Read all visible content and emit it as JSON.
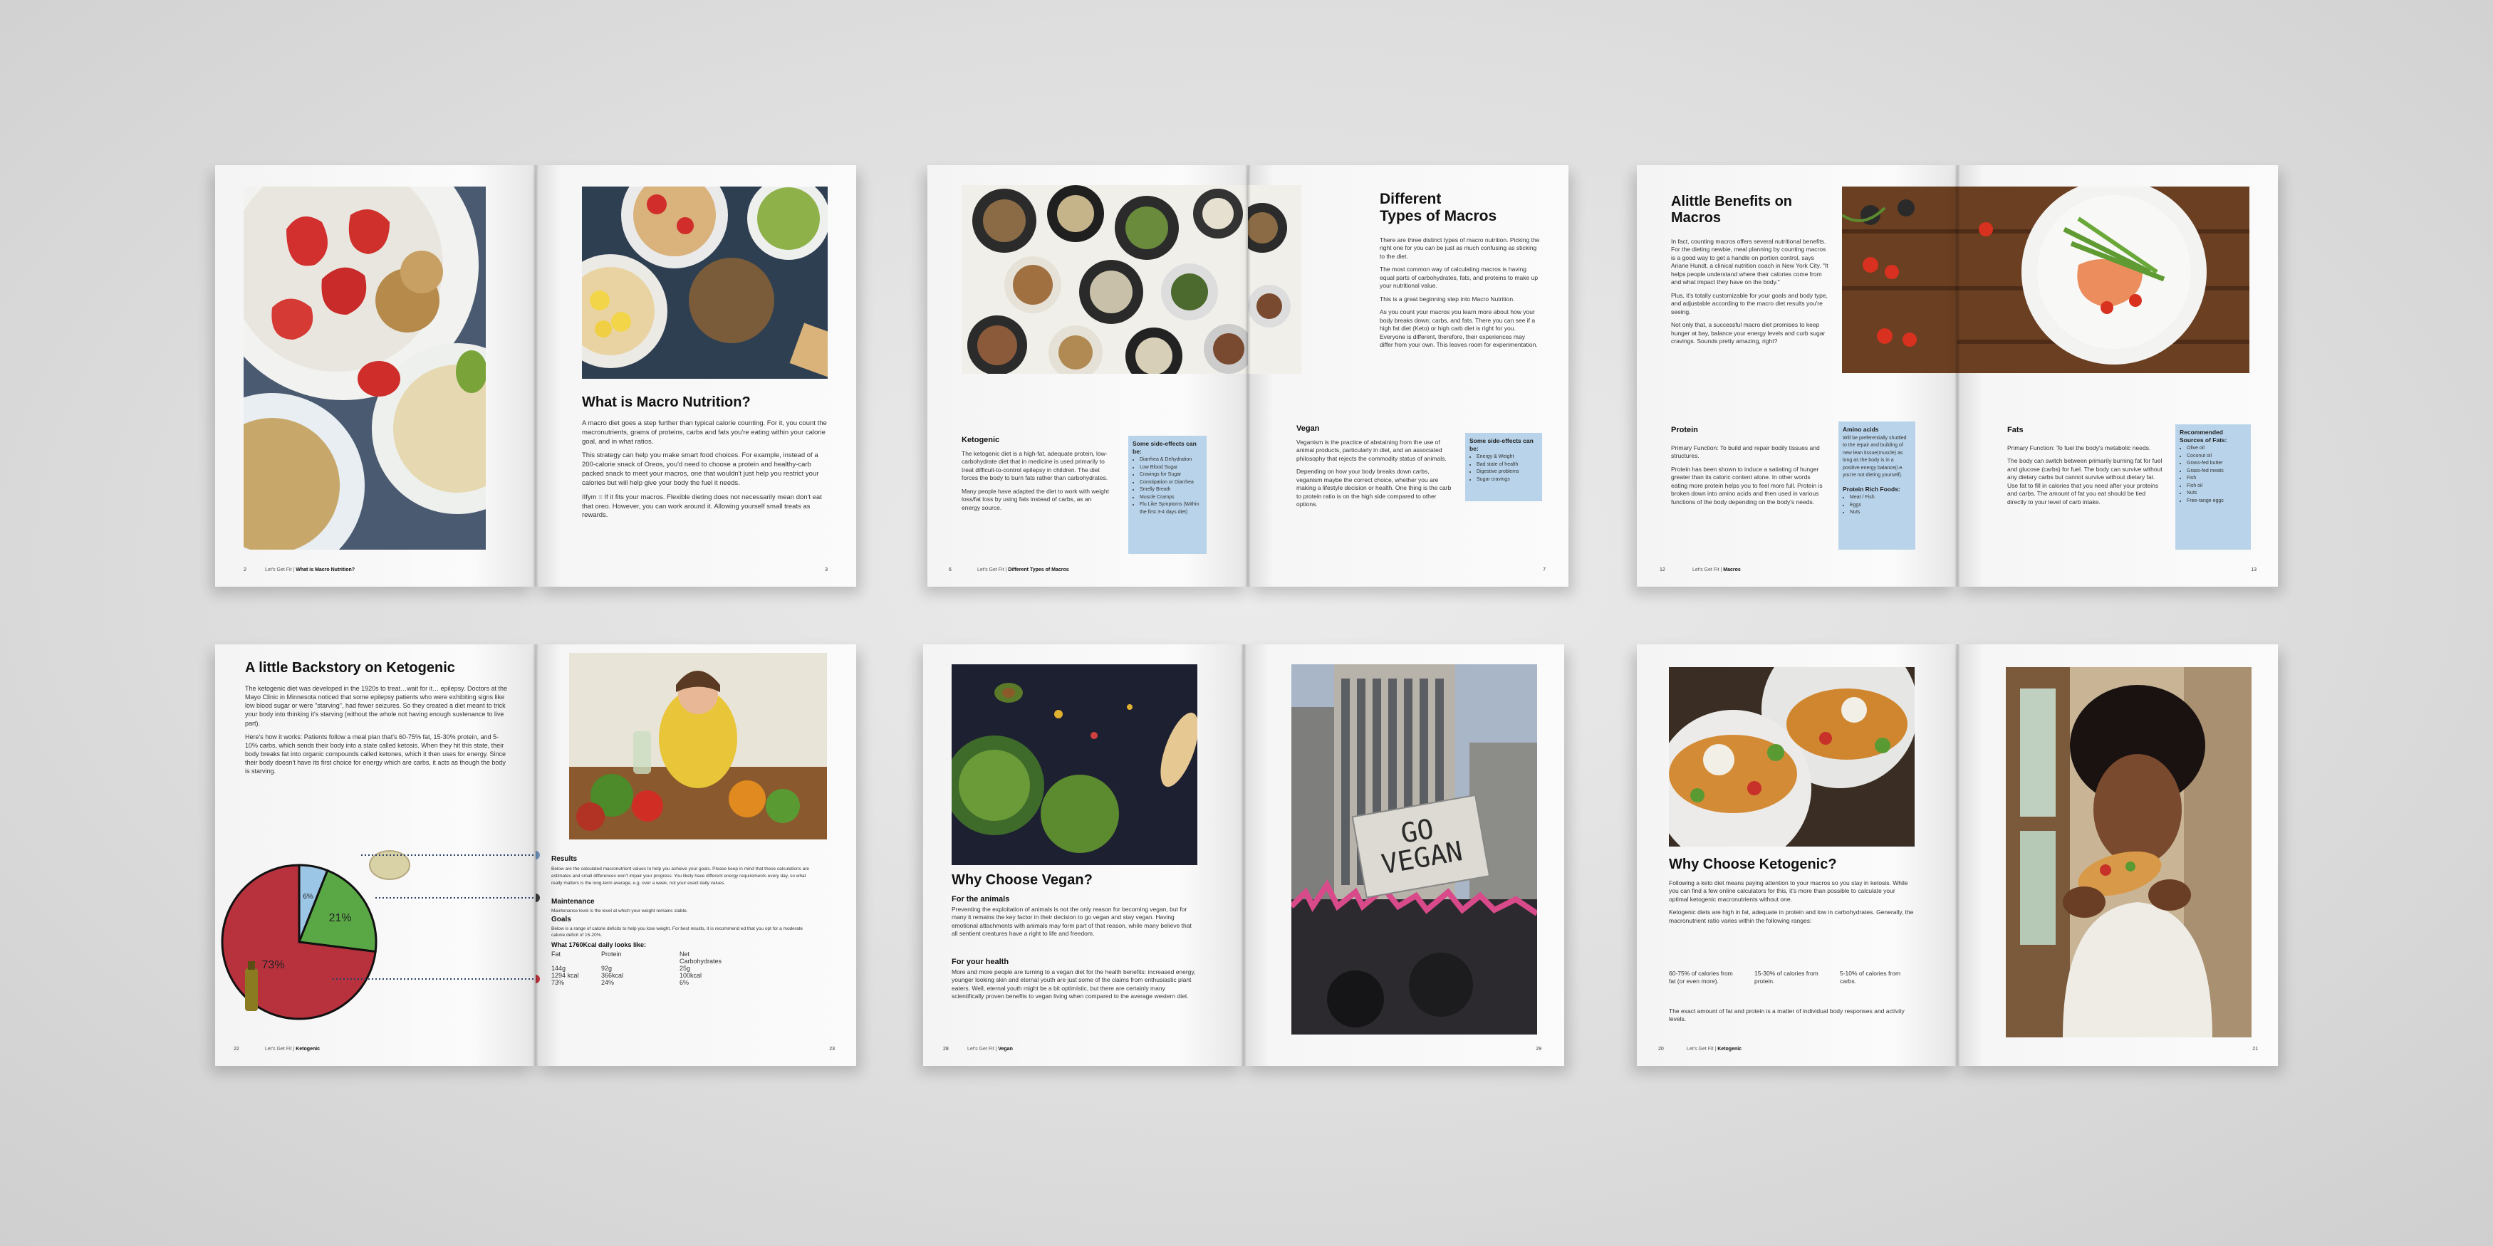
{
  "spread1": {
    "title": "What is Macro Nutrition?",
    "paragraphs": [
      "A macro diet goes a step further than typical calorie counting. For it, you count the macronutrients, grams of proteins, carbs and fats you're eating within your calorie goal, and in what ratios.",
      "This strategy can help you make smart food choices. For example, instead of a 200-calorie snack of Oreos, you'd need to choose a protein and healthy-carb packed snack to meet your macros, one that wouldn't just help you restrict your calories but will help give your body the fuel it needs.",
      "IIfym = If it fits your macros. Flexible dieting does not necessarily mean don't eat that oreo. However, you can work around it. Allowing yourself small treats as rewards."
    ],
    "page_left": "2",
    "footer": "Let's Get Fit",
    "footer_section": "What is Macro Nutrition?",
    "page_right": "3"
  },
  "spread2": {
    "title_line1": "Different",
    "title_line2": "Types of Macros",
    "paragraphs": [
      "There are three distinct types of macro nutrition. Picking the right one for you can be just as much confusing as sticking to the diet.",
      "The most common way of calculating macros is having equal parts of carbohydrates, fats, and proteins to make up your nutritional value.",
      "This is a great beginning step into Macro Nutrition.",
      "As you count your macros you learn more about how your body breaks down; carbs, and fats. There you can see if a high fat diet (Keto) or high carb diet is right for you. Everyone is different, therefore, their experiences may differ from your own. This leaves room for experimentation."
    ],
    "ketogenic_title": "Ketogenic",
    "ketogenic_paragraphs": [
      "The ketogenic diet is a high-fat, adequate protein, low-carbohydrate diet that in medicine is used primarily to treat difficult-to-control epilepsy in children. The diet forces the body to burn fats rather than carbohydrates.",
      "Many people have adapted the diet to work with weight loss/fat loss by using fats instead of carbs, as an energy source."
    ],
    "keto_side_title": "Some side-effects can be:",
    "keto_side_items": [
      "Diarrhea & Dehydration",
      "Low Blood Sugar",
      "Cravings for Sugar",
      "Constipation or Diarrhea",
      "Smelly Breath",
      "Muscle Cramps",
      "Flu Like Symptoms (Within the first 3-4 days diet)"
    ],
    "vegan_title": "Vegan",
    "vegan_paragraphs": [
      "Veganism is the practice of abstaining from the use of animal products, particularly in diet, and an associated philosophy that rejects the commodity status of animals.",
      "Depending on how your body breaks down carbs, veganism maybe the correct choice, whether you are making a lifestyle decision or health. One thing is the carb to protein ratio is on the high side compared to other options."
    ],
    "vegan_side_title": "Some side-effects can be:",
    "vegan_side_items": [
      "Energy & Weight",
      "Bad state of health",
      "Digestive problems",
      "Sugar cravings"
    ],
    "page_left": "6",
    "footer": "Let's Get Fit",
    "footer_section": "Different Types of Macros",
    "page_right": "7"
  },
  "spread3": {
    "title_line1": "Alittle Benefits on",
    "title_line2": "Macros",
    "paragraphs": [
      "In fact, counting macros offers several nutritional benefits. For the dieting newbie, meal planning by counting macros is a good way to get a handle on portion control, says Ariane Hundt, a clinical nutrition coach in New York City. \"It helps people understand where their calories come from and what impact they have on the body.\"",
      "Plus, it's totally customizable for your goals and body type, and adjustable according to the macro diet results you're seeing.",
      "Not only that, a successful macro diet promises to keep hunger at bay, balance your energy levels and curb sugar cravings. Sounds pretty amazing, right?"
    ],
    "protein_title": "Protein",
    "protein_paragraphs": [
      "Primary Function: To build and repair bodily tissues and structures.",
      "Protein has been shown to induce a satiating of hunger greater than its caloric content alone. In other words eating more protein helps you to feel more full. Protein is broken down into amino acids and then used in various functions of the body depending on the body's needs."
    ],
    "amino_title": "Amino acids",
    "amino_text": "Will be preferentially shuttled to the repair and building of new lean tissue(muscle) as long as the body is in a positive energy balance(i.e. you're not dieting yourself).",
    "protein_foods_title": "Protein Rich Foods:",
    "protein_foods": [
      "Meat / Fish",
      "Eggs",
      "Nuts"
    ],
    "fats_title": "Fats",
    "fats_paragraphs": [
      "Primary Function: To fuel the body's metabolic needs.",
      "The body can switch between primarily burning fat for fuel and glucose (carbs) for fuel. The body can survive without any dietary carbs but cannot survive without dietary fat. Use fat to fill in calories that you need after your proteins and carbs. The amount of fat you eat should be tied directly to your level of carb intake."
    ],
    "fats_side_title": "Recommended Sources of Fats:",
    "fats_side_items": [
      "Olive oil",
      "Coconut oil",
      "Grass-fed butter",
      "Grass-fed meats",
      "Fish",
      "Fish oil",
      "Nuts",
      "Free-range eggs"
    ],
    "page_left": "12",
    "footer": "Let's Get Fit",
    "footer_section": "Macros",
    "page_right": "13"
  },
  "spread4": {
    "title": "A little Backstory on Ketogenic",
    "paragraphs": [
      "The ketogenic diet was developed in the 1920s to treat…wait for it… epilepsy. Doctors at the Mayo Clinic in Minnesota noticed that some epilepsy patients who were exhibiting signs like low blood sugar or were \"starving\", had fewer seizures. So they created a diet meant to trick your body into thinking it's starving (without the whole not having enough sustenance to live part).",
      "Here's how it works: Patients follow a meal plan that's 60-75% fat, 15-30% protein, and 5-10% carbs, which sends their body into a state called ketosis. When they hit this state, their body breaks fat into organic compounds called ketones, which it then uses for energy. Since their body doesn't have its first choice for energy which are carbs, it acts as though the body is starving."
    ],
    "results_title": "Results",
    "results_text": "Below are the calculated macronutrient values to help you achieve your goals. Please keep in mind that these calculations are estimates and small differences won't impair your progress. You likely have different energy requirements every day, so what really matters is the long-term average, e.g. over a week, not your exact daily values.",
    "maintenance_title": "Maintenance",
    "maintenance_text": "Maintenance level is the level at which your weight remains stable.",
    "goals_title": "Goals",
    "goals_text": "Below is a range of calorie deficits to help you lose weight. For best results, it is recommend ed that you opt for a moderate calorie deficit of 15-20%.",
    "daily_title": "What 1760Kcal daily looks like:",
    "table_headers": [
      "Fat",
      "Protein",
      "Net Carbohydrates"
    ],
    "table_rows": [
      [
        "144g",
        "92g",
        "25g"
      ],
      [
        "1294 kcal",
        "366kcal",
        "100kcal"
      ],
      [
        "73%",
        "24%",
        "6%"
      ]
    ],
    "page_left": "22",
    "footer": "Let's Get Fit",
    "footer_section": "Ketogenic",
    "page_right": "23"
  },
  "spread5": {
    "title": "Why Choose Vegan?",
    "animals_title": "For the animals",
    "animals_text": "Preventing the exploitation of animals is not the only reason for becoming vegan, but for many it remains the key factor in their decision to go vegan and stay vegan. Having emotional attachments with animals may form part of that reason, while many believe that all sentient creatures have a right to life and freedom.",
    "health_title": "For your health",
    "health_text": "More and more people are turning to a vegan diet for the health benefits: increased energy, younger looking skin and eternal youth are just some of the claims from enthusiastic plant eaters. Well, eternal youth might be a bit optimistic, but there are certainly many scientifically proven benefits to vegan living when compared to the average western diet.",
    "sign_text": "GO VEGAN",
    "page_left": "28",
    "footer": "Let's Get Fit",
    "footer_section": "Vegan",
    "page_right": "29"
  },
  "spread6": {
    "title": "Why Choose Ketogenic?",
    "paragraphs": [
      "Following a keto diet means paying attention to your macros so you stay in ketosis. While you can find a few online calculators for this, it's more than possible to calculate your optimal ketogenic macronutrients without one.",
      "Ketogenic diets are high in fat, adequate in protein and low in carbohydrates. Generally, the macronutrient ratio varies within the following ranges:"
    ],
    "ranges": [
      "60-75% of calories from fat (or even more).",
      "15-30% of calories from protein.",
      "5-10% of calories from carbs."
    ],
    "closing": "The exact amount of fat and protein is a matter of individual body responses and activity levels.",
    "page_left": "20",
    "footer": "Let's Get Fit",
    "footer_section": "Ketogenic",
    "page_right": "21"
  },
  "chart_data": {
    "type": "pie",
    "categories": [
      "Fat",
      "Protein",
      "Net Carbohydrates"
    ],
    "values": [
      73,
      21,
      6
    ],
    "labels": [
      "73%",
      "21%",
      "6%"
    ],
    "colors": [
      "#b8323e",
      "#5aa845",
      "#9cc6e6"
    ]
  }
}
